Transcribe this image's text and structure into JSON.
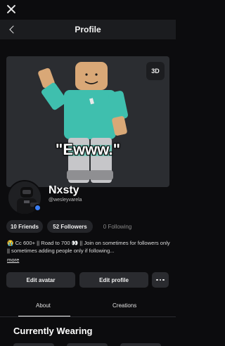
{
  "header": {
    "title": "Profile"
  },
  "avatar_view": {
    "toggle_3d_label": "3D",
    "caption": "\"Ewww.\""
  },
  "profile": {
    "display_name": "Nxsty",
    "username": "@wesleyvarela",
    "online": true
  },
  "stats": [
    {
      "label": "10 Friends"
    },
    {
      "label": "52 Followers"
    },
    {
      "label": "0 Following"
    }
  ],
  "bio": {
    "text": "😭 Cc 600+ || Road to 700 👀 || Join on sometimes for followers only || sometimes adding people only if following...",
    "more_label": "more"
  },
  "actions": {
    "edit_avatar": "Edit avatar",
    "edit_profile": "Edit profile"
  },
  "tabs": [
    {
      "label": "About",
      "active": true
    },
    {
      "label": "Creations",
      "active": false
    }
  ],
  "sections": {
    "currently_wearing": "Currently Wearing"
  },
  "colors": {
    "background": "#0c0c0e",
    "panel": "#2b2d31",
    "online_indicator": "#3a7ef5",
    "avatar_shirt": "#3fbfae",
    "avatar_skin": "#d9a877"
  }
}
